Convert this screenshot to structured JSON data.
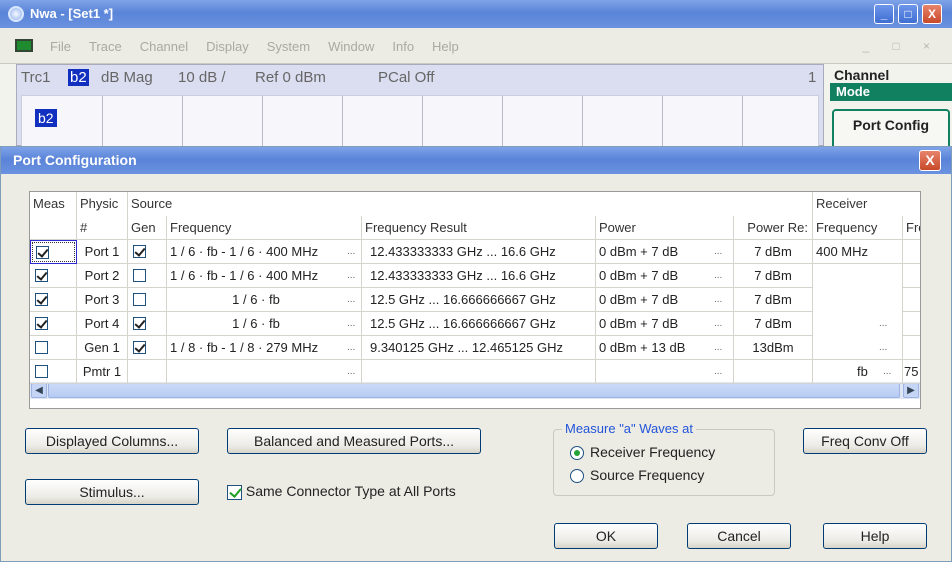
{
  "app": {
    "title": "Nwa - [Set1 *]"
  },
  "window_controls": {
    "minimize": "_",
    "maximize": "□",
    "close": "X"
  },
  "menu": [
    "File",
    "Trace",
    "Channel",
    "Display",
    "System",
    "Window",
    "Info",
    "Help"
  ],
  "menu_ctrls": "_ □ ×",
  "trace": {
    "name": "Trc1",
    "measure": "b2",
    "format": "dB Mag",
    "scale": "10 dB /",
    "ref": "Ref 0 dBm",
    "pcal": "PCal Off",
    "channel_no": "1",
    "marker": "b2"
  },
  "side": {
    "title": "Channel",
    "mode": "Mode",
    "button": "Port Config"
  },
  "dialog": {
    "title": "Port Configuration",
    "close": "X",
    "columns": {
      "meas": "Meas",
      "physic": "Physic",
      "source": "Source",
      "hash": "#",
      "gen": "Gen",
      "frequency": "Frequency",
      "freq_result": "Frequency Result",
      "power": "Power",
      "power_result": "Power Re:",
      "receiver": "Receiver",
      "rx_frequency": "Frequency",
      "fre": "Fre"
    },
    "rows": [
      {
        "meas": true,
        "port": "Port 1",
        "gen": true,
        "genbox": true,
        "frequency": "1 / 6 · fb - 1 / 6 · 400 MHz",
        "freq_result": "12.433333333 GHz ... 16.6 GHz",
        "power": "0 dBm + 7 dB",
        "power_result": "7 dBm",
        "rx_frequency": "400 MHz",
        "fre": ""
      },
      {
        "meas": true,
        "port": "Port 2",
        "gen": false,
        "genbox": true,
        "frequency": "1 / 6 · fb - 1 / 6 · 400 MHz",
        "freq_result": "12.433333333 GHz ... 16.6 GHz",
        "power": "0 dBm + 7 dB",
        "power_result": "7 dBm",
        "rx_frequency": "",
        "fre": ""
      },
      {
        "meas": true,
        "port": "Port 3",
        "gen": false,
        "genbox": true,
        "frequency": "1 / 6 · fb",
        "freq_result": "12.5 GHz ... 16.666666667 GHz",
        "power": "0 dBm + 7 dB",
        "power_result": "7 dBm",
        "rx_frequency": "",
        "fre": ""
      },
      {
        "meas": true,
        "port": "Port 4",
        "gen": true,
        "genbox": true,
        "frequency": "1 / 6 · fb",
        "freq_result": "12.5 GHz ... 16.666666667 GHz",
        "power": "0 dBm + 7 dB",
        "power_result": "7 dBm",
        "rx_frequency": "",
        "fre": ""
      },
      {
        "meas": false,
        "port": "Gen 1",
        "gen": true,
        "genbox": true,
        "frequency": "1 / 8 · fb - 1 / 8 · 279 MHz",
        "freq_result": "9.340125 GHz ... 12.465125 GHz",
        "power": "0 dBm + 13 dB",
        "power_result": "13dBm",
        "rx_frequency": "",
        "fre": ""
      },
      {
        "meas": false,
        "port": "Pmtr 1",
        "gen": false,
        "genbox": false,
        "frequency": "",
        "freq_result": "",
        "power": "",
        "power_result": "",
        "rx_frequency": "fb",
        "fre": "75"
      }
    ],
    "ellipsis": "...",
    "buttons": {
      "displayed_columns": "Displayed Columns...",
      "balanced": "Balanced and Measured Ports...",
      "stimulus": "Stimulus...",
      "freq_conv": "Freq Conv Off",
      "ok": "OK",
      "cancel": "Cancel",
      "help": "Help"
    },
    "same_connector": "Same Connector Type at All Ports",
    "same_connector_checked": true,
    "measure_group": {
      "legend": "Measure \"a\" Waves at",
      "options": [
        "Receiver Frequency",
        "Source Frequency"
      ],
      "selected": "Receiver Frequency"
    },
    "scroll_left": "◀",
    "scroll_right": "▶"
  }
}
